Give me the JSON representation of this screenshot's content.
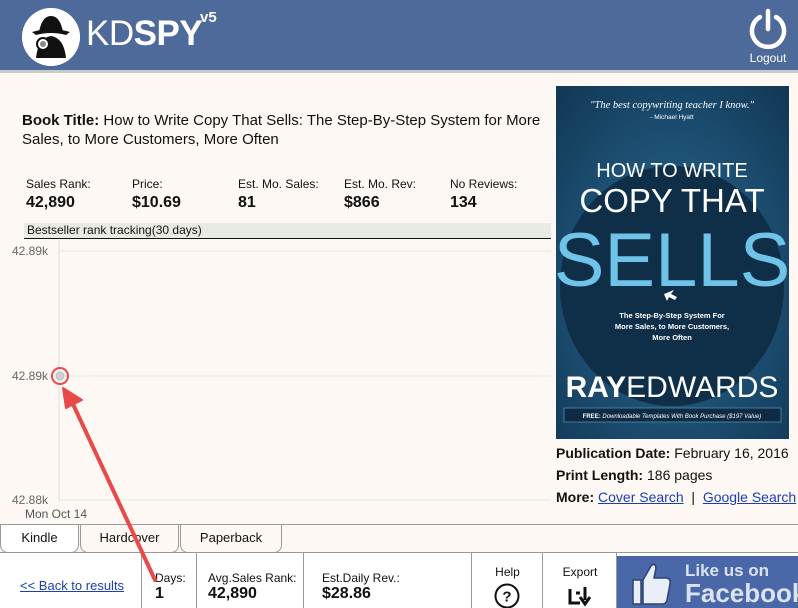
{
  "header": {
    "logo_kd": "KD",
    "logo_spy": "SPY",
    "logo_version": "v5",
    "logout_label": "Logout"
  },
  "book": {
    "title_label": "Book Title:",
    "title": "How to Write Copy That Sells: The Step-By-Step System for More Sales, to More Customers, More Often"
  },
  "stats": [
    {
      "label": "Sales Rank:",
      "value": "42,890"
    },
    {
      "label": "Price:",
      "value": "$10.69"
    },
    {
      "label": "Est. Mo. Sales:",
      "value": "81"
    },
    {
      "label": "Est. Mo. Rev:",
      "value": "$866"
    },
    {
      "label": "No Reviews:",
      "value": "134"
    }
  ],
  "tracking_label": "Bestseller rank tracking(30 days)",
  "chart_data": {
    "type": "line",
    "x": [
      "Mon Oct 14"
    ],
    "series": [
      {
        "values": [
          42890
        ]
      }
    ],
    "y_tick_labels": [
      "42.89k",
      "42.89k",
      "42.88k"
    ],
    "grid": true
  },
  "cover": {
    "quote": "\"The best copywriting teacher I know.\"",
    "quote_author": "- Michael Hyatt",
    "line1": "HOW TO WRITE",
    "line2": "COPY THAT",
    "line3": "SELLS",
    "subtitle1": "The Step-By-Step System For",
    "subtitle2": "More Sales, to More Customers,",
    "subtitle3": "More Often",
    "author_first": "RAY",
    "author_last": "EDWARDS",
    "free_prefix": "FREE:",
    "free_note": "Downloadable Templates With Book Purchase ($197 Value)"
  },
  "publication": {
    "date_label": "Publication Date:",
    "date": "February 16, 2016",
    "length_label": "Print Length:",
    "length": "186 pages",
    "more_label": "More:",
    "cover_search": "Cover Search",
    "separator": "|",
    "google_search": "Google Search"
  },
  "tabs": [
    "Kindle",
    "Hardcover",
    "Paperback"
  ],
  "bottom": {
    "back_link": "<< Back to results",
    "days_label": "Days:",
    "days_value": "1",
    "avg_label": "Avg.Sales Rank:",
    "avg_value": "42,890",
    "rev_label": "Est.Daily Rev.:",
    "rev_value": "$28.86",
    "help_label": "Help",
    "export_label": "Export",
    "fb_line1": "Like us on",
    "fb_line2": "Facebook"
  },
  "colors": {
    "header_bg": "#4e6a9a",
    "link": "#1a3eb8",
    "cover_bg": "#1b4e74",
    "cover_accent": "#6fc3e8",
    "arrow": "#e84a4a",
    "facebook": "#3b5998"
  }
}
